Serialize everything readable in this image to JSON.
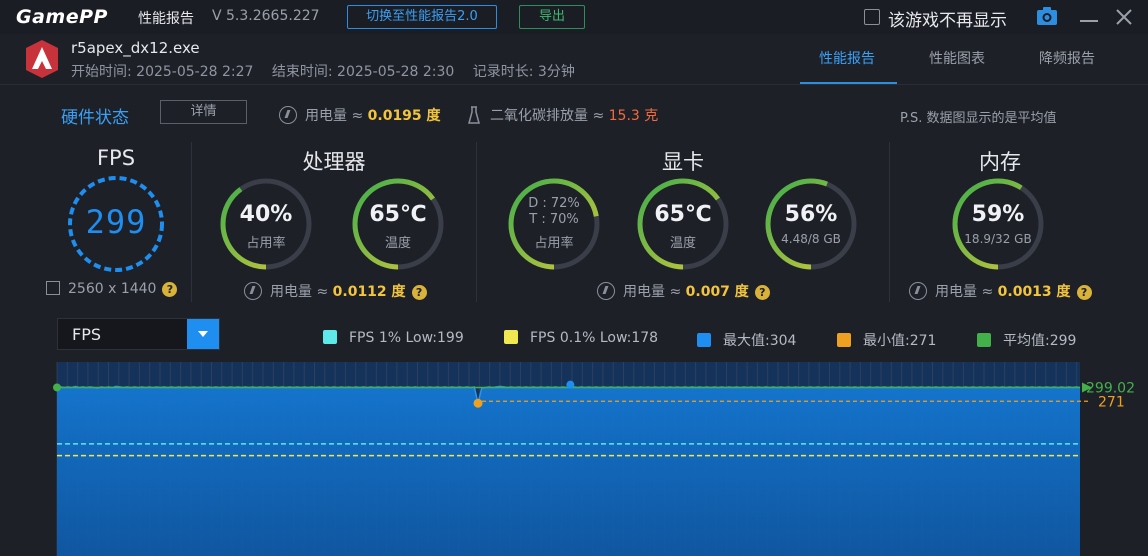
{
  "titlebar": {
    "logo": "GamePP",
    "title": "性能报告",
    "version": "V 5.3.2665.227",
    "switch_button": "切换至性能报告2.0",
    "export_button": "导出",
    "hide_checkbox_label": "该游戏不再显示"
  },
  "session": {
    "exe": "r5apex_dx12.exe",
    "start": "开始时间: 2025-05-28 2:27",
    "end": "结束时间: 2025-05-28 2:30",
    "duration": "记录时长: 3分钟"
  },
  "tabs": [
    "性能报告",
    "性能图表",
    "降频报告"
  ],
  "status": {
    "title": "硬件状态",
    "detail_button": "详情",
    "power_label": "用电量 ≈",
    "power_value": "0.0195 度",
    "co2_label": "二氧化碳排放量 ≈",
    "co2_value": "15.3 克",
    "note": "P.S. 数据图显示的是平均值"
  },
  "fps": {
    "title": "FPS",
    "value": "299",
    "resolution": "2560 x 1440"
  },
  "cpu": {
    "title": "处理器",
    "usage": "40%",
    "usage_label": "占用率",
    "usage_fraction": 0.4,
    "temp": "65℃",
    "temp_label": "温度",
    "temp_fraction": 0.65,
    "power_label": "用电量 ≈",
    "power_value": "0.0112 度"
  },
  "gpu": {
    "title": "显卡",
    "d_usage": "D : 72%",
    "t_usage": "T : 70%",
    "usage_label": "占用率",
    "usage_fraction": 0.72,
    "temp": "65℃",
    "temp_label": "温度",
    "temp_fraction": 0.65,
    "vram": "56%",
    "vram_detail": "4.48/8 GB",
    "vram_fraction": 0.56,
    "power_label": "用电量 ≈",
    "power_value": "0.007 度"
  },
  "memory": {
    "title": "内存",
    "usage": "59%",
    "usage_detail": "18.9/32 GB",
    "usage_fraction": 0.59,
    "power_label": "用电量 ≈",
    "power_value": "0.0013 度"
  },
  "chart_controls": {
    "selected_metric": "FPS"
  },
  "legend": [
    {
      "label": "FPS 1% Low:199",
      "color": "#5fe8e8"
    },
    {
      "label": "FPS 0.1% Low:178",
      "color": "#f0e850"
    },
    {
      "label": "最大值:304",
      "color": "#1e8ef0"
    },
    {
      "label": "最小值:271",
      "color": "#f0a020"
    },
    {
      "label": "平均值:299",
      "color": "#44b04a"
    }
  ],
  "chart_data": {
    "type": "area",
    "series": [
      {
        "name": "FPS",
        "values": [
          299,
          300,
          299,
          300,
          299,
          301,
          299,
          300,
          299,
          300,
          299,
          298,
          300,
          299,
          300,
          299,
          301,
          300,
          299,
          300,
          299,
          300,
          299,
          300,
          299,
          300,
          299,
          300,
          299,
          300,
          299,
          300,
          299,
          300,
          299,
          300,
          299,
          300,
          299,
          300,
          299,
          300,
          299,
          300,
          299,
          300,
          299,
          300,
          299,
          300,
          299,
          300,
          299,
          300,
          299,
          300,
          299,
          300,
          299,
          300,
          299,
          300,
          299,
          300,
          299,
          300,
          299,
          300,
          299,
          300,
          299,
          300,
          299,
          300,
          299,
          300,
          299,
          300,
          299,
          300,
          299,
          300,
          299,
          300,
          299,
          300,
          299,
          300,
          299,
          300,
          299,
          300,
          299,
          300,
          299,
          300,
          299,
          300,
          299,
          300,
          299,
          300,
          299,
          300,
          299,
          300,
          299,
          300,
          299,
          300,
          299,
          300,
          299,
          300,
          271,
          298,
          299,
          300,
          299,
          300,
          301,
          300,
          299,
          300,
          299,
          300,
          299,
          300,
          299,
          300,
          299,
          300,
          299,
          300,
          299,
          300,
          299,
          300,
          299,
          304,
          300,
          299,
          300,
          299,
          300,
          299,
          300,
          299,
          300,
          299,
          300,
          299,
          300,
          299,
          300,
          299,
          300,
          299,
          300,
          299,
          300,
          299,
          300,
          299,
          300,
          299,
          300,
          299,
          300,
          299,
          300,
          299,
          300,
          299,
          300,
          299,
          300,
          299,
          300,
          299,
          300,
          299,
          300,
          299,
          300,
          299,
          300,
          299,
          300,
          299,
          300,
          299,
          300,
          299,
          300,
          299,
          300,
          299,
          300,
          299,
          300,
          299,
          300,
          299,
          300,
          299,
          300,
          299,
          300,
          299,
          300,
          299,
          300,
          299,
          300,
          299,
          300,
          299,
          300,
          299,
          300,
          299,
          300,
          299,
          300,
          299,
          300,
          299,
          300,
          299,
          300,
          299,
          300,
          299,
          300,
          299,
          300,
          299,
          300,
          299,
          300,
          299,
          300,
          299,
          300,
          299,
          300,
          299,
          300,
          299,
          300,
          299,
          300,
          299,
          300,
          299,
          300,
          299,
          300,
          299,
          300,
          299,
          300,
          299,
          300,
          299,
          300,
          299,
          300,
          299,
          300,
          299,
          300,
          299,
          300,
          299,
          300,
          299
        ]
      }
    ],
    "reference_lines": {
      "fps_1pct_low": 199,
      "fps_01pct_low": 178,
      "max": 304,
      "min": 271,
      "avg": 299
    },
    "labels": {
      "avg": "299.02",
      "min": "271"
    },
    "ylim": [
      0,
      330
    ]
  }
}
